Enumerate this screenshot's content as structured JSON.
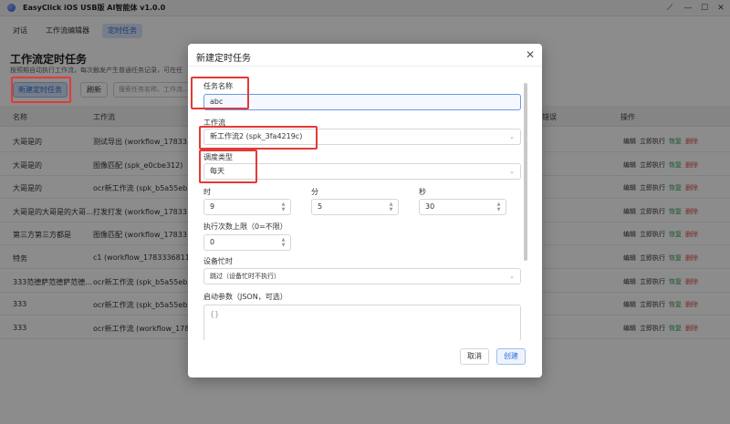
{
  "window": {
    "title": "EasyClick iOS USB版 AI智能体 v1.0.0"
  },
  "tabs": [
    {
      "label": "对话",
      "active": false
    },
    {
      "label": "工作流编辑器",
      "active": false
    },
    {
      "label": "定时任务",
      "active": true
    }
  ],
  "page": {
    "title": "工作流定时任务",
    "subtitle": "按预期自动执行工作流，每次触发产生普通任务记录，可在任"
  },
  "toolbar": {
    "new_label": "新建定时任务",
    "refresh_label": "刷新",
    "search_placeholder": "搜索任务名称、工作流..."
  },
  "table": {
    "headers": {
      "name": "名称",
      "workflow": "工作流",
      "error": "错误",
      "actions": "操作"
    },
    "rows": [
      {
        "name": "大哥是的",
        "workflow": "测试导出 (workflow_17833..."
      },
      {
        "name": "大哥是的",
        "workflow": "图像匹配 (spk_e0cbe312)"
      },
      {
        "name": "大哥是的",
        "workflow": "ocr新工作流 (spk_b5a55eb7)"
      },
      {
        "name": "大哥是的大哥是的大哥...",
        "workflow": "打发打发 (workflow_17833..."
      },
      {
        "name": "第三方第三方都是",
        "workflow": "图像匹配 (workflow_17833..."
      },
      {
        "name": "特务",
        "workflow": "c1 (workflow_1783336811..."
      },
      {
        "name": "333范德萨范德萨范德...",
        "workflow": "ocr新工作流 (spk_b5a55eb7)"
      },
      {
        "name": "333",
        "workflow": "ocr新工作流 (spk_b5a55eb7)"
      },
      {
        "name": "333",
        "workflow": "ocr新工作流 (workflow_178..."
      }
    ],
    "action_labels": {
      "edit": "编辑",
      "run": "立即执行",
      "resume": "恢复",
      "delete": "删除"
    }
  },
  "modal": {
    "title": "新建定时任务",
    "task_name_label": "任务名称",
    "task_name_value": "abc",
    "workflow_label": "工作流",
    "workflow_value": "新工作流2 (spk_3fa4219c)",
    "schedule_label": "调度类型",
    "schedule_value": "每天",
    "hour_label": "时",
    "hour_value": "9",
    "minute_label": "分",
    "minute_value": "5",
    "second_label": "秒",
    "second_value": "30",
    "max_runs_label": "执行次数上限（0=不限）",
    "max_runs_value": "0",
    "device_busy_label": "设备忙时",
    "device_busy_value": "跳过（设备忙时不执行）",
    "params_label": "启动参数（JSON，可选）",
    "params_value": "{}",
    "cancel_label": "取消",
    "create_label": "创建"
  },
  "colors": {
    "accent": "#2f6fd6",
    "highlight": "#e53935",
    "resume": "#3aa04a",
    "delete": "#e24b4b"
  }
}
